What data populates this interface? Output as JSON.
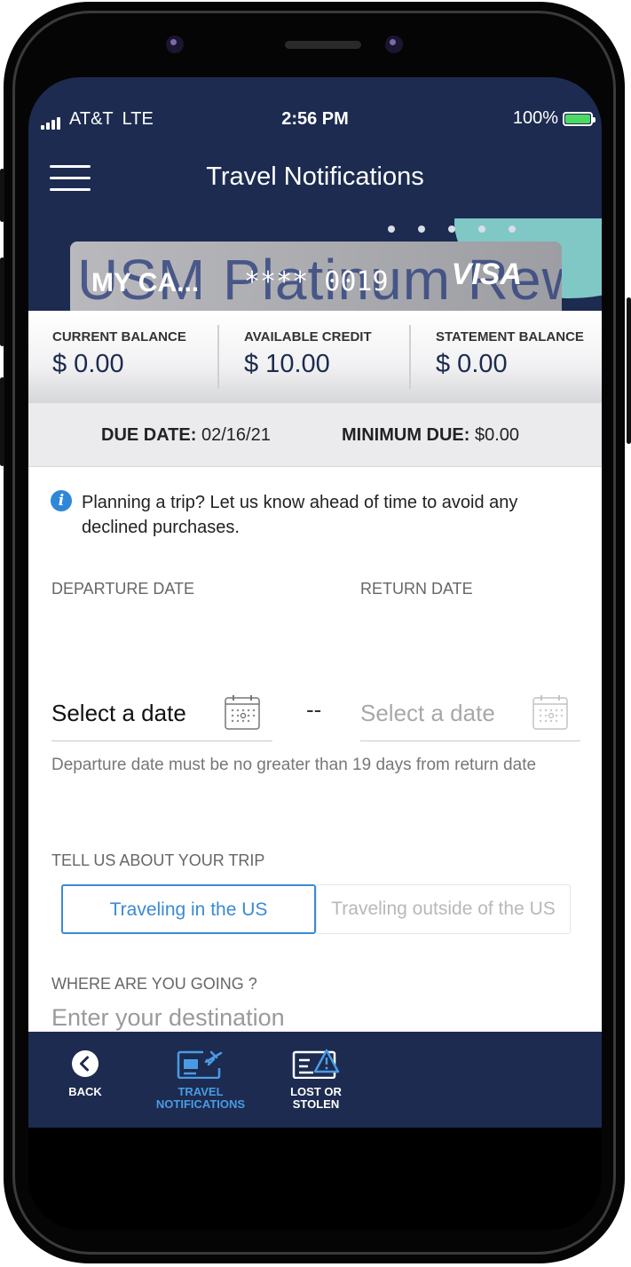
{
  "status_bar": {
    "carrier": "AT&T",
    "network": "LTE",
    "time": "2:56 PM",
    "battery": "100%"
  },
  "header": {
    "title": "Travel Notifications"
  },
  "card": {
    "name": "MY CA...",
    "masked_number": "**** 0019",
    "brand": "VISA",
    "watermark": "USM Platinum Rew",
    "carousel_dots": 5
  },
  "balances": [
    {
      "label": "CURRENT BALANCE",
      "value": "$ 0.00"
    },
    {
      "label": "AVAILABLE CREDIT",
      "value": "$ 10.00"
    },
    {
      "label": "STATEMENT BALANCE",
      "value": "$ 0.00"
    }
  ],
  "due": {
    "due_label": "DUE DATE:",
    "due_value": "02/16/21",
    "min_label": "MINIMUM DUE:",
    "min_value": "$0.00"
  },
  "info": {
    "text": "Planning a trip? Let us know ahead of time to avoid any declined purchases."
  },
  "departure": {
    "label": "DEPARTURE DATE",
    "placeholder": "Select a date"
  },
  "return": {
    "label": "RETURN DATE",
    "placeholder": "Select a date"
  },
  "date_separator": "--",
  "hint": "Departure date must be no greater than 19 days from return date",
  "trip": {
    "label": "TELL US ABOUT YOUR TRIP",
    "options": [
      "Traveling in the US",
      "Traveling outside of the US"
    ],
    "selected": "Traveling in the US"
  },
  "destination": {
    "label": "WHERE ARE YOU GOING ?",
    "placeholder": "Enter your destination"
  },
  "tabs": [
    {
      "label": "BACK",
      "icon": "back-chevron-icon"
    },
    {
      "label": "TRAVEL NOTIFICATIONS",
      "icon": "card-plane-icon",
      "active": true
    },
    {
      "label": "LOST OR STOLEN",
      "icon": "card-warning-icon"
    }
  ],
  "colors": {
    "navy": "#1c2b4f",
    "accent": "#3b8ad3",
    "teal": "#7fc8c6",
    "active_tab": "#4a9be6"
  }
}
